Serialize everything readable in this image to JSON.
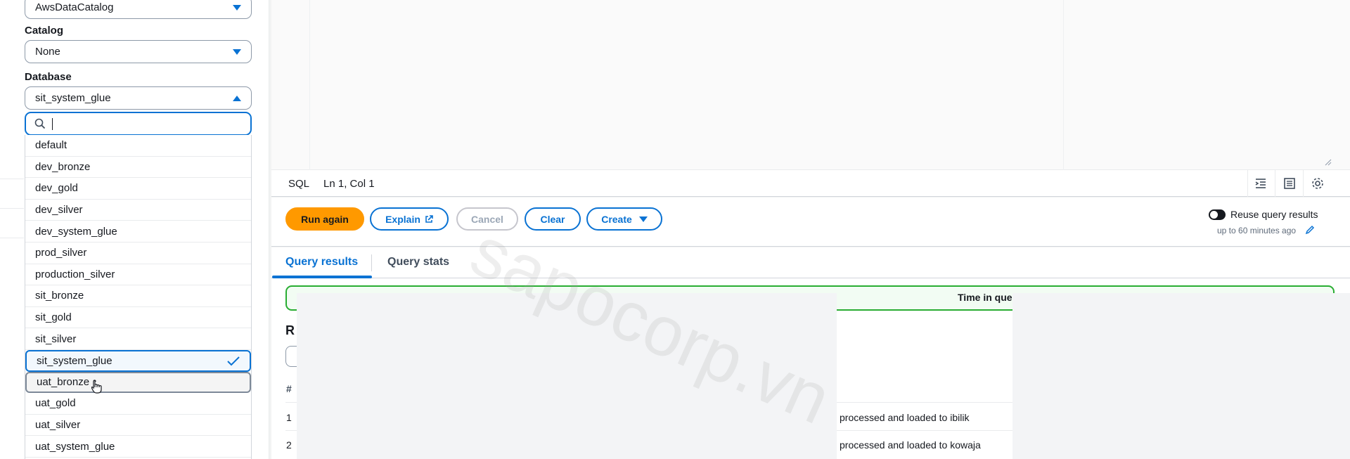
{
  "left_panel": {
    "data_source": {
      "value": "AwsDataCatalog"
    },
    "catalog": {
      "label": "Catalog",
      "value": "None"
    },
    "database": {
      "label": "Database",
      "value": "sit_system_glue",
      "search_placeholder": "",
      "options": [
        "default",
        "dev_bronze",
        "dev_gold",
        "dev_silver",
        "dev_system_glue",
        "prod_silver",
        "production_silver",
        "sit_bronze",
        "sit_gold",
        "sit_silver",
        "sit_system_glue",
        "uat_bronze",
        "uat_gold",
        "uat_silver",
        "uat_system_glue"
      ],
      "selected_option": "sit_system_glue",
      "hovered_option": "uat_bronze"
    }
  },
  "editor": {
    "language": "SQL",
    "cursor_position": "Ln 1, Col 1"
  },
  "toolbar": {
    "run_label": "Run again",
    "explain_label": "Explain",
    "cancel_label": "Cancel",
    "clear_label": "Clear",
    "create_label": "Create",
    "reuse_label": "Reuse query results",
    "reuse_sub": "up to 60 minutes ago"
  },
  "tabs": {
    "results_label": "Query results",
    "stats_label": "Query stats"
  },
  "results": {
    "banner_text": "Time in que",
    "title": "R",
    "header_hash": "#",
    "rows": [
      {
        "num": "1",
        "text": "processed and loaded to ibilik"
      },
      {
        "num": "2",
        "text": "processed and loaded to kowaja"
      }
    ]
  },
  "watermark": "sapocorp.vn",
  "colors": {
    "accent": "#0972d3",
    "primary_button": "#ff9900",
    "success_border": "#29ad32"
  }
}
